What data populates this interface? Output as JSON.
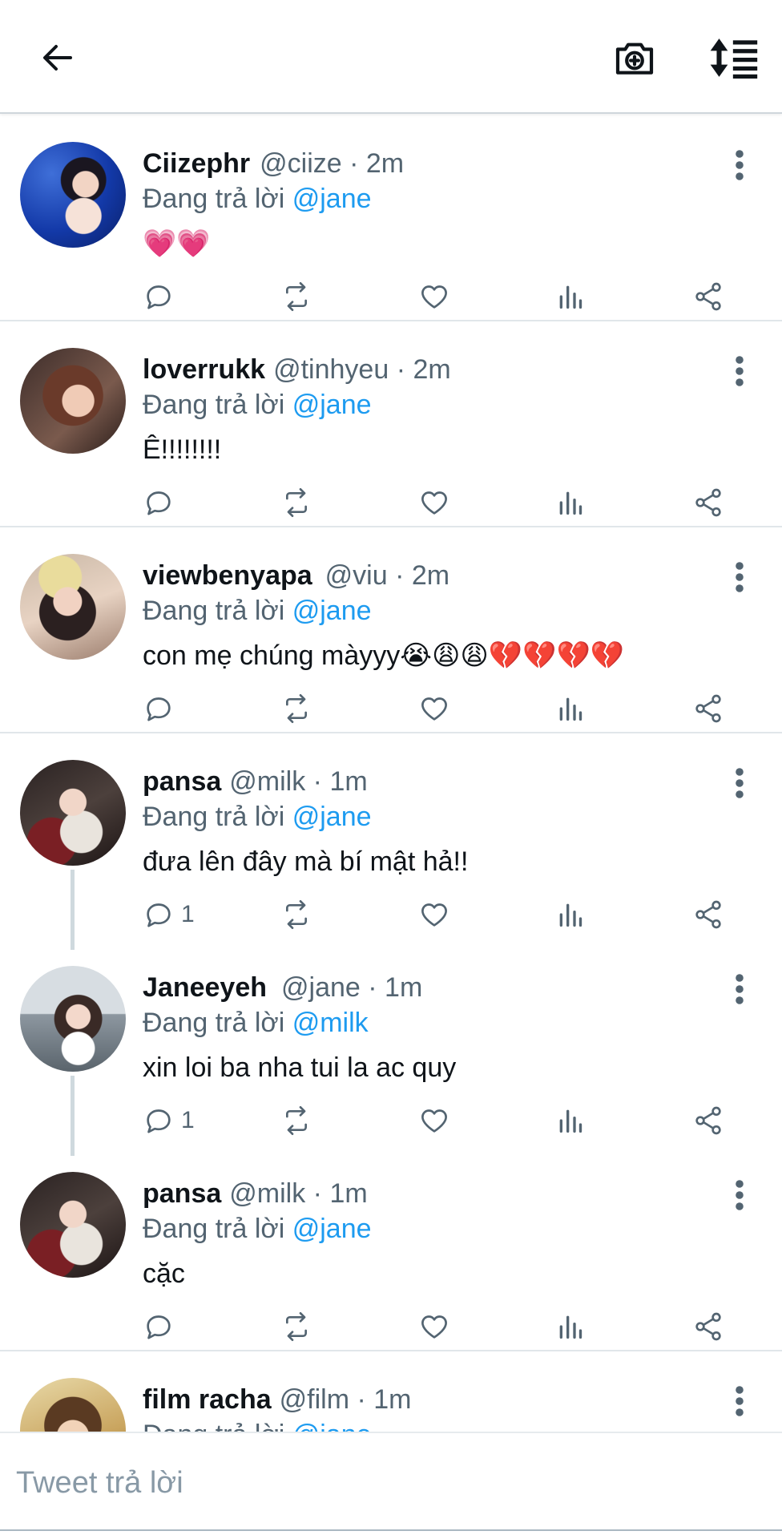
{
  "header": {
    "back_icon": "arrow-left-icon",
    "camera_icon": "camera-plus-icon",
    "sort_icon": "sort-order-icon"
  },
  "tweets": [
    {
      "name": "Ciizephr",
      "handle": "@ciize",
      "separator": "·",
      "time": "2m",
      "reply_prefix": "Đang trả lời",
      "reply_to": "@jane",
      "text": "💗💗",
      "reply_count": ""
    },
    {
      "name": "loverrukk",
      "handle": "@tinhyeu",
      "separator": "·",
      "time": "2m",
      "reply_prefix": "Đang trả lời",
      "reply_to": "@jane",
      "text": "Ê!!!!!!!!",
      "reply_count": ""
    },
    {
      "name": "viewbenyapa",
      "handle": "@viu",
      "separator": "·",
      "time": "2m",
      "reply_prefix": "Đang trả lời",
      "reply_to": "@jane",
      "text": "con mẹ chúng màyyy😭😩😩💔💔💔💔",
      "reply_count": ""
    },
    {
      "name": "pansa",
      "handle": "@milk",
      "separator": "·",
      "time": "1m",
      "reply_prefix": "Đang trả lời",
      "reply_to": "@jane",
      "text": "đưa lên đây mà bí mật hả!!",
      "reply_count": "1"
    },
    {
      "name": "Janeeyeh",
      "handle": "@jane",
      "separator": "·",
      "time": "1m",
      "reply_prefix": "Đang trả lời",
      "reply_to": "@milk",
      "text": "xin loi ba nha tui la ac quy",
      "reply_count": "1"
    },
    {
      "name": "pansa",
      "handle": "@milk",
      "separator": "·",
      "time": "1m",
      "reply_prefix": "Đang trả lời",
      "reply_to": "@jane",
      "text": "cặc",
      "reply_count": ""
    },
    {
      "name": "film racha",
      "handle": "@film",
      "separator": "·",
      "time": "1m",
      "reply_prefix": "Đang trả lời",
      "reply_to": "@jane",
      "text": "",
      "reply_count": ""
    }
  ],
  "actions": {
    "reply_icon": "reply-bubble-icon",
    "retweet_icon": "retweet-icon",
    "like_icon": "heart-icon",
    "views_icon": "bar-chart-icon",
    "share_icon": "share-icon",
    "more_icon": "more-vertical-icon"
  },
  "composer": {
    "placeholder": "Tweet trả lời"
  },
  "colors": {
    "mention": "#1d9bf0",
    "secondary_text": "#536471",
    "primary_text": "#0f1419",
    "divider": "#e1e6ea"
  }
}
